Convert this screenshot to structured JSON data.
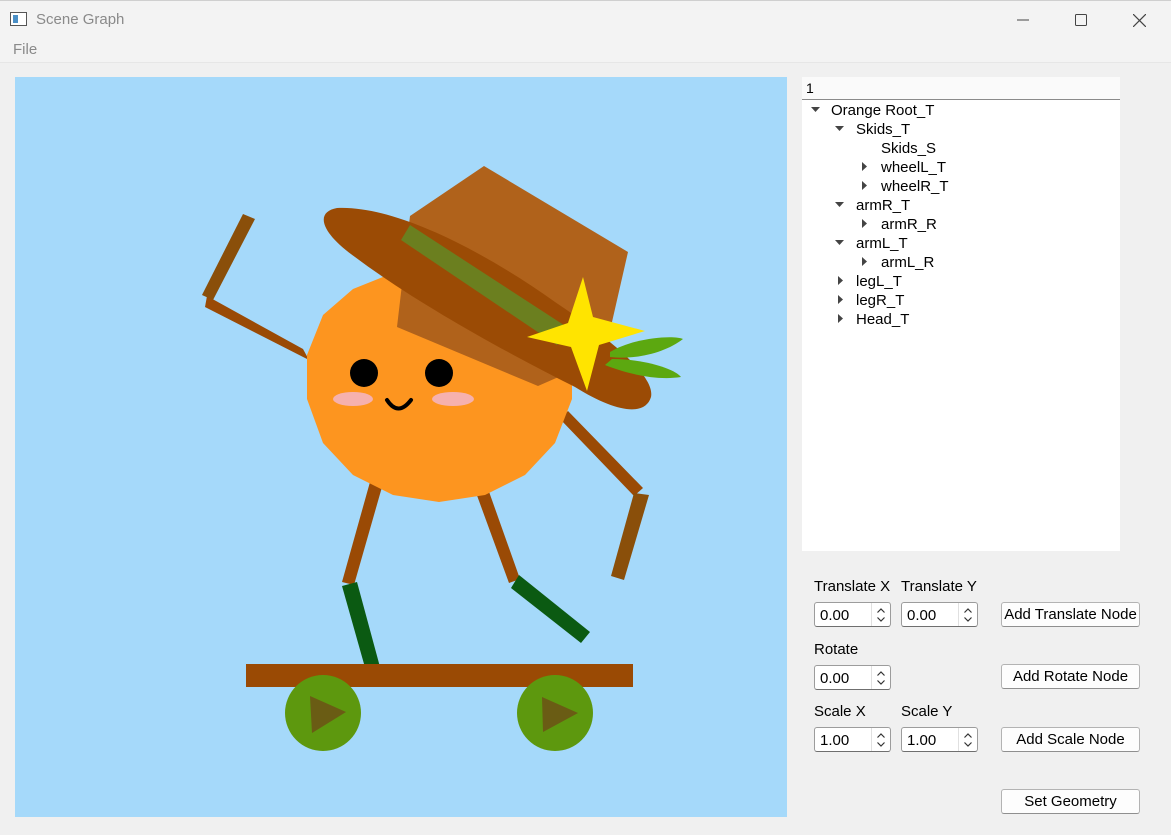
{
  "window": {
    "title": "Scene Graph"
  },
  "menu": {
    "file": "File"
  },
  "tree": {
    "header": "1",
    "nodes": [
      {
        "label": "Orange Root_T",
        "expander": "expanded"
      },
      {
        "label": "Skids_T",
        "expander": "expanded"
      },
      {
        "label": "Skids_S",
        "expander": "none"
      },
      {
        "label": "wheelL_T",
        "expander": "collapsed"
      },
      {
        "label": "wheelR_T",
        "expander": "collapsed"
      },
      {
        "label": "armR_T",
        "expander": "expanded"
      },
      {
        "label": "armR_R",
        "expander": "collapsed"
      },
      {
        "label": "armL_T",
        "expander": "expanded"
      },
      {
        "label": "armL_R",
        "expander": "collapsed"
      },
      {
        "label": "legL_T",
        "expander": "collapsed"
      },
      {
        "label": "legR_T",
        "expander": "collapsed"
      },
      {
        "label": "Head_T",
        "expander": "collapsed"
      }
    ]
  },
  "controls": {
    "translate_x_label": "Translate X",
    "translate_y_label": "Translate Y",
    "translate_x_value": "0.00",
    "translate_y_value": "0.00",
    "add_translate": "Add Translate Node",
    "rotate_label": "Rotate",
    "rotate_value": "0.00",
    "add_rotate": "Add Rotate Node",
    "scale_x_label": "Scale X",
    "scale_y_label": "Scale Y",
    "scale_x_value": "1.00",
    "scale_y_value": "1.00",
    "add_scale": "Add Scale Node",
    "set_geometry": "Set Geometry"
  },
  "colors": {
    "canvas_bg": "#a5d9fa",
    "orange": "#fd951f",
    "hat": "#b0621b",
    "hat_brim": "#9b4b05",
    "hat_band": "#6b7f1f",
    "star": "#ffe400",
    "leaf": "#5ca810",
    "limb": "#9a4a05",
    "boot": "#0b5a12",
    "wheel": "#5d980e",
    "board": "#9a4a04"
  }
}
